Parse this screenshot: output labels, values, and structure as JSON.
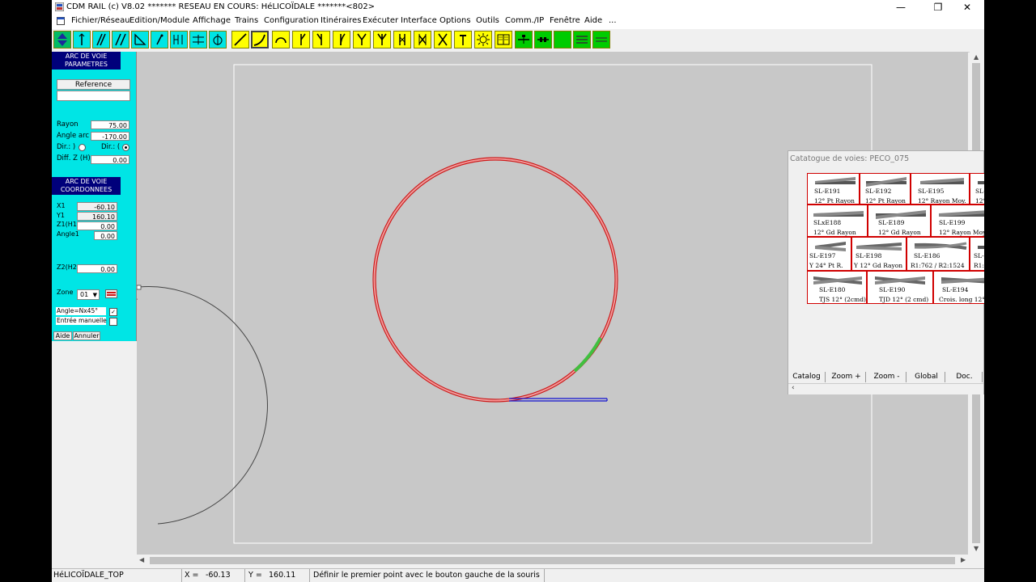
{
  "window": {
    "title": "CDM RAIL (c) V8.02      ******* RESEAU EN COURS: HéLICOÏDALE *******<802>",
    "minimize_icon": "minimize-icon",
    "maximize_icon": "restore-icon",
    "close_icon": "close-icon"
  },
  "menu": [
    "Fichier/Réseau",
    "Edition/Module",
    "Affichage",
    "Trains",
    "Configuration",
    "Itinéraires",
    "Exécuter",
    "Interface",
    "Options",
    "Outils",
    "Comm./IP",
    "Fenêtre",
    "Aide",
    "..."
  ],
  "colors": {
    "panel": "#00e5e5",
    "track_red": "#d01818",
    "track_green": "#40c040",
    "track_blue": "#1010d0",
    "toolbar_yellow": "#ffff00",
    "toolbar_green": "#00cc00"
  },
  "panel": {
    "params_header": [
      "ARC DE VOIE",
      "PARAMETRES"
    ],
    "reference_label": "Reference",
    "reference_value": "",
    "rayon_label": "Rayon",
    "rayon_value": "75.00",
    "angle_arc_label": "Angle arc",
    "angle_arc_value": "-170.00",
    "dir_label_left": "Dir.: )",
    "dir_label_right": "Dir.: (",
    "diffz_label": "Diff. Z (H)",
    "diffz_value": "0.00",
    "coords_header": [
      "ARC DE VOIE",
      "COORDONNEES"
    ],
    "x1_label": "X1",
    "x1_value": "-60.10",
    "y1_label": "Y1",
    "y1_value": "160.10",
    "z1_label": "Z1(H1)",
    "z1_value": "0.00",
    "angle1_label": "Angle1",
    "angle1_value": "0.00",
    "z2_label": "Z2(H2)",
    "z2_value": "0.00",
    "zone_label": "Zone",
    "zone_value": "01",
    "angle_nx_label": "Angle=Nx45°",
    "angle_nx_checked": true,
    "entree_label": "Entrée manuelle",
    "entree_checked": false,
    "aide_button": "Aide",
    "annuler_button": "Annuler"
  },
  "catalog": {
    "title": "Catatogue de voies: PECO_075",
    "items": [
      {
        "code": "SL-E191",
        "desc": "12° Pt Rayon"
      },
      {
        "code": "SL-E192",
        "desc": "12° Pt Rayon"
      },
      {
        "code": "SL-E195",
        "desc": "12° Rayon Moy."
      },
      {
        "code": "SL-E",
        "desc": "12°"
      },
      {
        "code": "SLxE188",
        "desc": "12° Gd Rayon"
      },
      {
        "code": "SL-E189",
        "desc": "12° Gd Rayon"
      },
      {
        "code": "SL-E199",
        "desc": "12° Rayon Moy."
      },
      {
        "code": "SL-E197",
        "desc": "Y 24° Pt R."
      },
      {
        "code": "SL-E198",
        "desc": "Y 12° Gd Rayon"
      },
      {
        "code": "SL-E186",
        "desc": "R1:762 / R2:1524"
      },
      {
        "code": "SL-",
        "desc": "R1:"
      },
      {
        "code": "SL-E180",
        "desc": "TJS 12° (2cmd)"
      },
      {
        "code": "SL-E190",
        "desc": "TJD 12° (2 cmd)"
      },
      {
        "code": "SL-E194",
        "desc": "Crois. long 12°"
      }
    ],
    "buttons": [
      "Catalog",
      "Zoom +",
      "Zoom -",
      "Global",
      "Doc."
    ]
  },
  "status": {
    "layer": "HéLICOÏDALE_TOP",
    "x_label": "X =",
    "x_value": "-60.13",
    "y_label": "Y =",
    "y_value": "160.11",
    "message": "Définir le premier point avec le bouton gauche de la souris"
  }
}
